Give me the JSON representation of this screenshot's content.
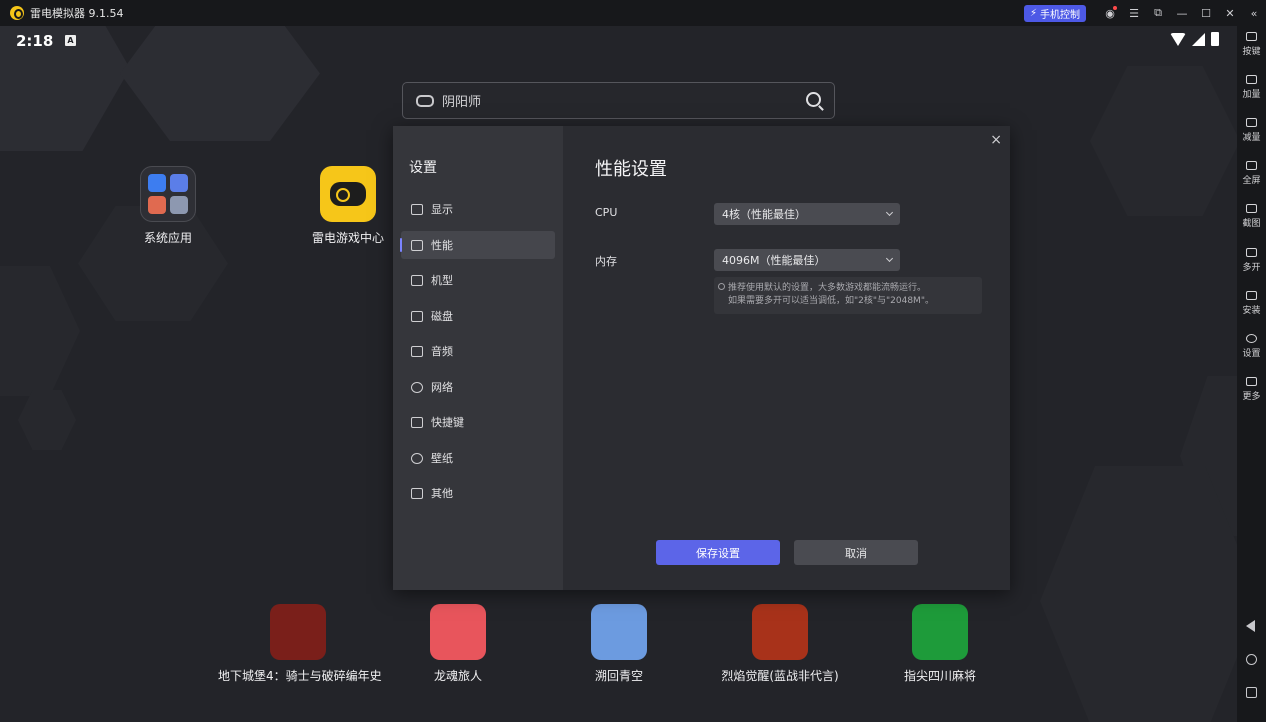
{
  "window": {
    "title": "雷电模拟器 9.1.54",
    "phone_control": "手机控制",
    "collapse_glyph": "«"
  },
  "status": {
    "time": "2:18",
    "keyboard_badge": "A"
  },
  "search": {
    "query": "阴阳师"
  },
  "desktop": {
    "apps": [
      {
        "label": "系统应用"
      },
      {
        "label": "雷电游戏中心"
      }
    ]
  },
  "dock": {
    "apps": [
      {
        "label": "地下城堡4：骑士与破碎编年史",
        "color": "#7a1f1a"
      },
      {
        "label": "龙魂旅人",
        "color": "#e8555c"
      },
      {
        "label": "溯回青空",
        "color": "#6c9be0"
      },
      {
        "label": "烈焰觉醒(蓝战非代言)",
        "color": "#a8321a"
      },
      {
        "label": "指尖四川麻将",
        "color": "#1e9b3a"
      }
    ]
  },
  "settings": {
    "sidebar_title": "设置",
    "items": [
      {
        "label": "显示",
        "icon": "monitor-icon"
      },
      {
        "label": "性能",
        "icon": "performance-icon",
        "active": true
      },
      {
        "label": "机型",
        "icon": "folder-icon"
      },
      {
        "label": "磁盘",
        "icon": "disk-icon"
      },
      {
        "label": "音频",
        "icon": "gamepad-icon"
      },
      {
        "label": "网络",
        "icon": "globe-icon"
      },
      {
        "label": "快捷键",
        "icon": "keyboard-icon"
      },
      {
        "label": "壁纸",
        "icon": "palette-icon"
      },
      {
        "label": "其他",
        "icon": "grid-icon"
      }
    ],
    "close_glyph": "×",
    "title": "性能设置",
    "cpu": {
      "label": "CPU",
      "value": "4核（性能最佳）"
    },
    "memory": {
      "label": "内存",
      "value": "4096M（性能最佳）"
    },
    "hint_line1": "推荐使用默认的设置，大多数游戏都能流畅运行。",
    "hint_line2": "如果需要多开可以适当调低，如\"2核\"与\"2048M\"。",
    "save_label": "保存设置",
    "cancel_label": "取消"
  },
  "toolbar": {
    "items": [
      {
        "label": "按键"
      },
      {
        "label": "加量"
      },
      {
        "label": "减量"
      },
      {
        "label": "全屏"
      },
      {
        "label": "截图"
      },
      {
        "label": "多开"
      },
      {
        "label": "安装"
      },
      {
        "label": "设置"
      },
      {
        "label": "更多"
      }
    ]
  }
}
